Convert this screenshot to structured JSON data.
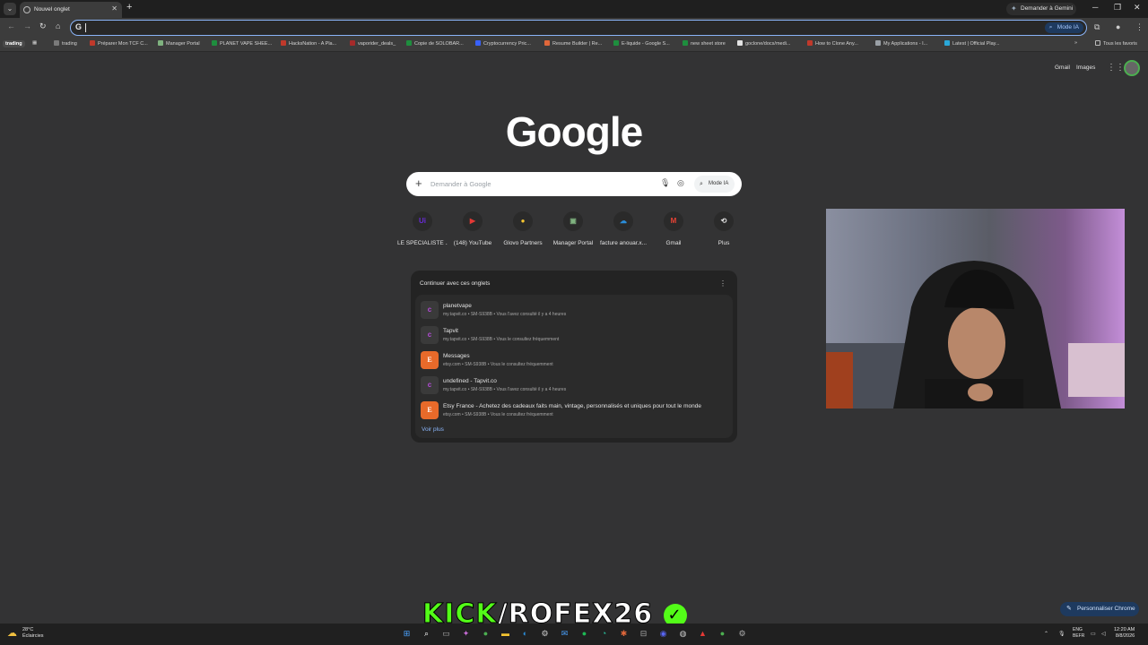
{
  "browser": {
    "tab_title": "Nouvel onglet",
    "gemini_button": "Demander à Gemini",
    "omnibox_mode": "Mode IA"
  },
  "bookmarks": [
    {
      "label": "trading",
      "color": "#7a7a7a"
    },
    {
      "label": "Préparer Mon TCF C...",
      "color": "#c0392b"
    },
    {
      "label": "Manager Portal",
      "color": "#7fb27f"
    },
    {
      "label": "PLANET VAPE SHEE...",
      "color": "#1e8e3e"
    },
    {
      "label": "HacksNation - A Pla...",
      "color": "#c0392b"
    },
    {
      "label": "vaporider_deals_",
      "color": "#a52a2a"
    },
    {
      "label": "Copie de SOLOBAR...",
      "color": "#1e8e3e"
    },
    {
      "label": "Cryptocurrency Pric...",
      "color": "#3861fb"
    },
    {
      "label": "Resume Builder | Re...",
      "color": "#e0673a"
    },
    {
      "label": "E-liquide - Google S...",
      "color": "#1e8e3e"
    },
    {
      "label": "new sheet store",
      "color": "#1e8e3e"
    },
    {
      "label": "goclone/docs/medi...",
      "color": "#e3e3e3"
    },
    {
      "label": "How to Clone Any...",
      "color": "#c0392b"
    },
    {
      "label": "My Applications - I...",
      "color": "#9aa0a6"
    },
    {
      "label": "Latest | Official Play...",
      "color": "#2aa7d8"
    }
  ],
  "bookmarks_first": "trading",
  "bookmarks_all": "Tous les favoris",
  "top_links": {
    "gmail": "Gmail",
    "images": "Images"
  },
  "logo": "Google",
  "search": {
    "placeholder": "Demander à Google",
    "mode_ia": "Mode IA"
  },
  "shortcuts": [
    {
      "label": "LE SPÉCIALISTE ...",
      "glyph": "Ui",
      "color": "#6a2bd8"
    },
    {
      "label": "(148) YouTube",
      "glyph": "▶",
      "color": "#e53935"
    },
    {
      "label": "Glovo Partners",
      "glyph": "●",
      "color": "#f4c430"
    },
    {
      "label": "Manager Portal",
      "glyph": "▣",
      "color": "#7fb27f"
    },
    {
      "label": "facture anouar.x...",
      "glyph": "☁",
      "color": "#2a8cd8"
    },
    {
      "label": "Gmail",
      "glyph": "M",
      "color": "#ea4335"
    },
    {
      "label": "Plus",
      "glyph": "⟲",
      "color": "#e3e3e3"
    }
  ],
  "tabs_card": {
    "title": "Continuer avec ces onglets",
    "more": "Voir plus",
    "rows": [
      {
        "name": "planetvape",
        "meta": "my.tapvit.co • SM-S938B • Vous l'avez consulté il y a 4 heures",
        "type": "tap"
      },
      {
        "name": "Tapvit",
        "meta": "my.tapvit.co • SM-S938B • Vous le consultez fréquemment",
        "type": "tap"
      },
      {
        "name": "Messages",
        "meta": "etsy.com • SM-S938B • Vous le consultez fréquemment",
        "type": "etsy"
      },
      {
        "name": "undefined - Tapvit.co",
        "meta": "my.tapvit.co • SM-S938B • Vous l'avez consulté il y a 4 heures",
        "type": "tap"
      },
      {
        "name": "Etsy France - Achetez des cadeaux faits main, vintage, personnalisés et uniques pour tout le monde",
        "meta": "etsy.com • SM-S938B • Vous le consultez fréquemment",
        "type": "etsy"
      }
    ]
  },
  "overlay": {
    "kick": "KICK",
    "channel": "/ROFEX26"
  },
  "customize_button": "Personnaliser Chrome",
  "taskbar": {
    "temp": "28°C",
    "weather": "Éclaircies",
    "lang1": "ENG",
    "lang2": "BEFR",
    "time": "12:20 AM",
    "date": "8/8/2026"
  }
}
